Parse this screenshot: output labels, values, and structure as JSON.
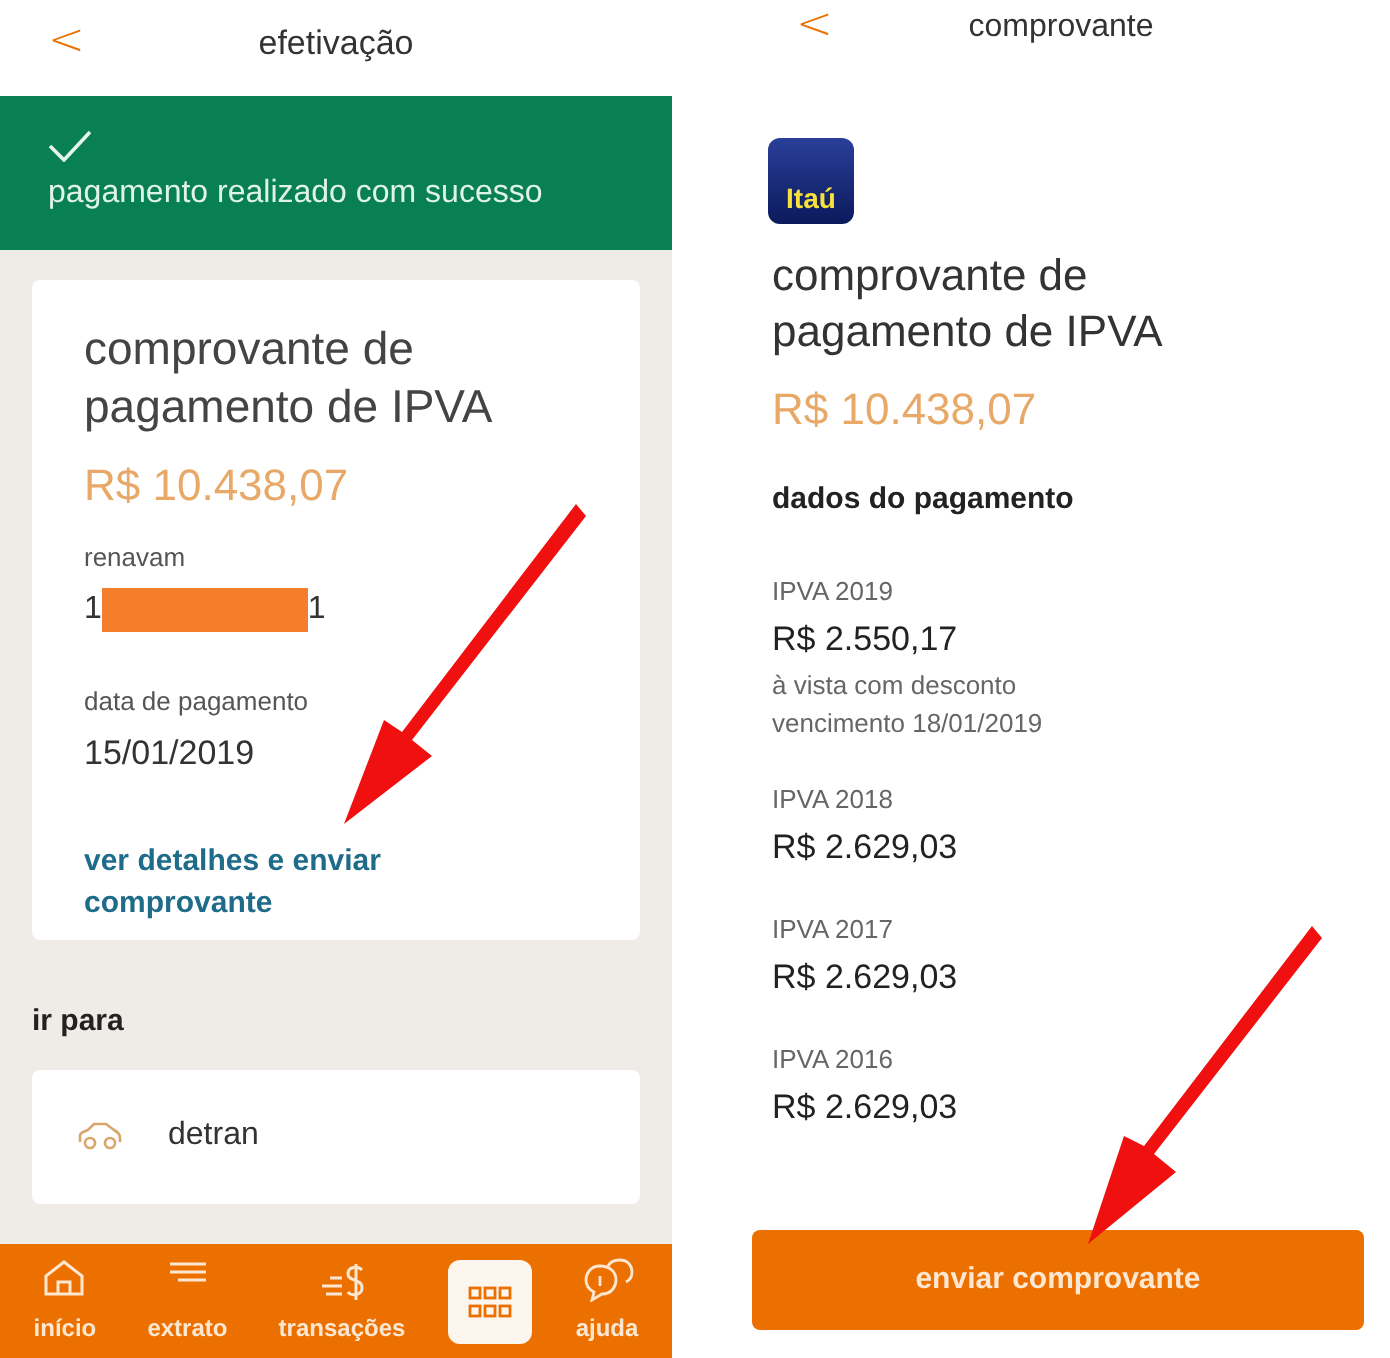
{
  "left_screen": {
    "header": {
      "back": "<",
      "title": "efetivação"
    },
    "banner": {
      "message": "pagamento realizado com sucesso"
    },
    "card": {
      "title": "comprovante de pagamento de IPVA",
      "amount": "R$ 10.438,07",
      "fields": [
        {
          "kind": "redacted",
          "label": "renavam",
          "value_start": "1",
          "value_end": "1"
        },
        {
          "kind": "plain",
          "label": "data de pagamento",
          "value": "15/01/2019"
        }
      ],
      "link": "ver detalhes e enviar comprovante"
    },
    "section_title": "ir para",
    "shortcuts": [
      {
        "label": "detran"
      }
    ],
    "bottom_nav": [
      {
        "kind": "home",
        "label": "início",
        "selected": false
      },
      {
        "kind": "statement",
        "label": "extrato",
        "selected": false
      },
      {
        "kind": "transfer",
        "label": "transações",
        "selected": false
      },
      {
        "kind": "grid",
        "selected": true
      },
      {
        "kind": "help",
        "label": "ajuda",
        "selected": false
      }
    ]
  },
  "right_screen": {
    "header": {
      "back": "<",
      "title": "comprovante"
    },
    "logo": "Itaú",
    "title": "comprovante de pagamento de IPVA",
    "amount": "R$ 10.438,07",
    "section_title": "dados do pagamento",
    "items": [
      {
        "label": "IPVA 2019",
        "value": "R$ 2.550,17",
        "notes": [
          "à vista com desconto",
          "vencimento 18/01/2019"
        ]
      },
      {
        "label": "IPVA 2018",
        "value": "R$ 2.629,03"
      },
      {
        "label": "IPVA 2017",
        "value": "R$ 2.629,03"
      },
      {
        "label": "IPVA 2016",
        "value": "R$ 2.629,03"
      }
    ],
    "button": "enviar comprovante"
  }
}
